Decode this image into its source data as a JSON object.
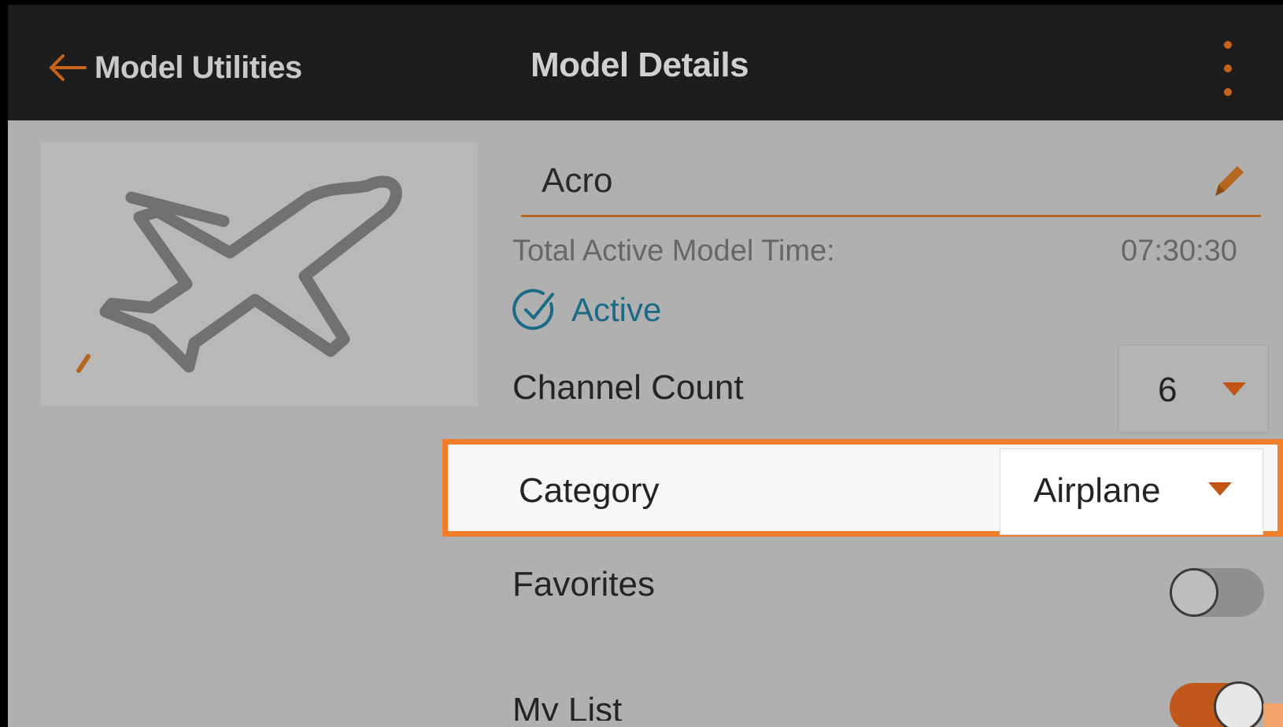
{
  "header": {
    "back_label": "Model Utilities",
    "title": "Model Details",
    "menu_icon": "kebab-menu-icon"
  },
  "model": {
    "image_icon": "airplane-icon",
    "name": "Acro",
    "edit_icon": "pencil-icon",
    "time_label": "Total Active Model Time:",
    "time_value": "07:30:30",
    "status_icon": "check-circle-icon",
    "status_label": "Active"
  },
  "settings": {
    "channel_count_label": "Channel Count",
    "channel_count_value": "6",
    "category_label": "Category",
    "category_value": "Airplane",
    "favorites_label": "Favorites",
    "favorites_on": false,
    "mylist_label": "My List",
    "mylist_on": true
  },
  "colors": {
    "header_bg": "#1d1d1d",
    "accent_orange": "#c8651a",
    "highlight_border": "#f07e2a",
    "active_blue": "#1b6a86",
    "screen_bg": "#b0b0b0"
  }
}
